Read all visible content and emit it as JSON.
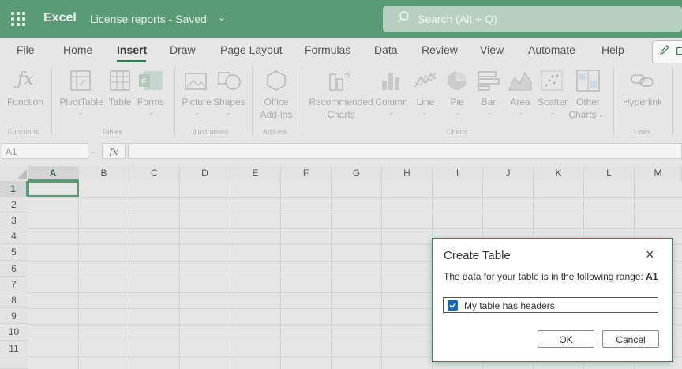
{
  "titlebar": {
    "app_name": "Excel",
    "doc_name": "License reports  -  Saved",
    "chevron": "⌄",
    "search_placeholder": "Search (Alt + Q)"
  },
  "menu": {
    "tabs": [
      "File",
      "Home",
      "Insert",
      "Draw",
      "Page Layout",
      "Formulas",
      "Data",
      "Review",
      "View",
      "Automate",
      "Help"
    ],
    "active_tab": "Insert",
    "editing_label": "Ed"
  },
  "ribbon": {
    "function_label": "Function",
    "pivottable_label": "PivotTable",
    "table_label": "Table",
    "forms_label": "Forms",
    "picture_label": "Picture",
    "shapes_label": "Shapes",
    "office_label": "Office",
    "addins_label": "Add-ins",
    "recommended_label": "Recommended",
    "charts_label": "Charts",
    "column_label": "Column",
    "line_label": "Line",
    "pie_label": "Pie",
    "bar_label": "Bar",
    "area_label": "Area",
    "scatter_label": "Scatter",
    "other_label": "Other",
    "other_charts_label": "Charts",
    "hyperlink_label": "Hyperlink",
    "caret": "⌄",
    "groups": {
      "functions": "Functions",
      "tables": "Tables",
      "illustrations": "Illustrations",
      "addins": "Add-ins",
      "charts": "Charts",
      "links": "Links"
    }
  },
  "formula_bar": {
    "name_box": "A1",
    "fx": "fx"
  },
  "grid": {
    "columns": [
      "A",
      "B",
      "C",
      "D",
      "E",
      "F",
      "G",
      "H",
      "I",
      "J",
      "K",
      "L",
      "M"
    ],
    "rows": [
      "1",
      "2",
      "3",
      "4",
      "5",
      "6",
      "7",
      "8",
      "9",
      "10",
      "11"
    ],
    "selected_cell": "A1"
  },
  "dialog": {
    "title": "Create Table",
    "close": "×",
    "message": "The data for your table is in the following range: ",
    "range": "A1",
    "checkbox_label": "My table has headers",
    "checkbox_checked": true,
    "ok_label": "OK",
    "cancel_label": "Cancel"
  },
  "colors": {
    "accent": "#5b9a76",
    "checkbox": "#0f6cbd"
  }
}
